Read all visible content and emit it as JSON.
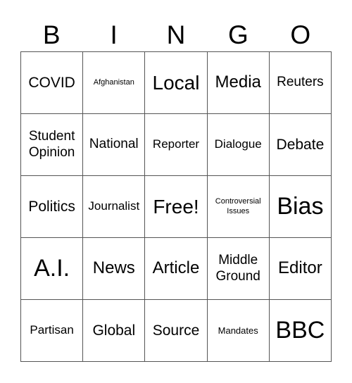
{
  "header": {
    "letters": [
      "B",
      "I",
      "N",
      "G",
      "O"
    ]
  },
  "card": {
    "rows": [
      [
        "COVID",
        "Afghanistan",
        "Local",
        "Media",
        "Reuters"
      ],
      [
        "Student Opinion",
        "National",
        "Reporter",
        "Dialogue",
        "Debate"
      ],
      [
        "Politics",
        "Journalist",
        "Free!",
        "Controversial Issues",
        "Bias"
      ],
      [
        "A.I.",
        "News",
        "Article",
        "Middle Ground",
        "Editor"
      ],
      [
        "Partisan",
        "Global",
        "Source",
        "Mandates",
        "BBC"
      ]
    ]
  }
}
